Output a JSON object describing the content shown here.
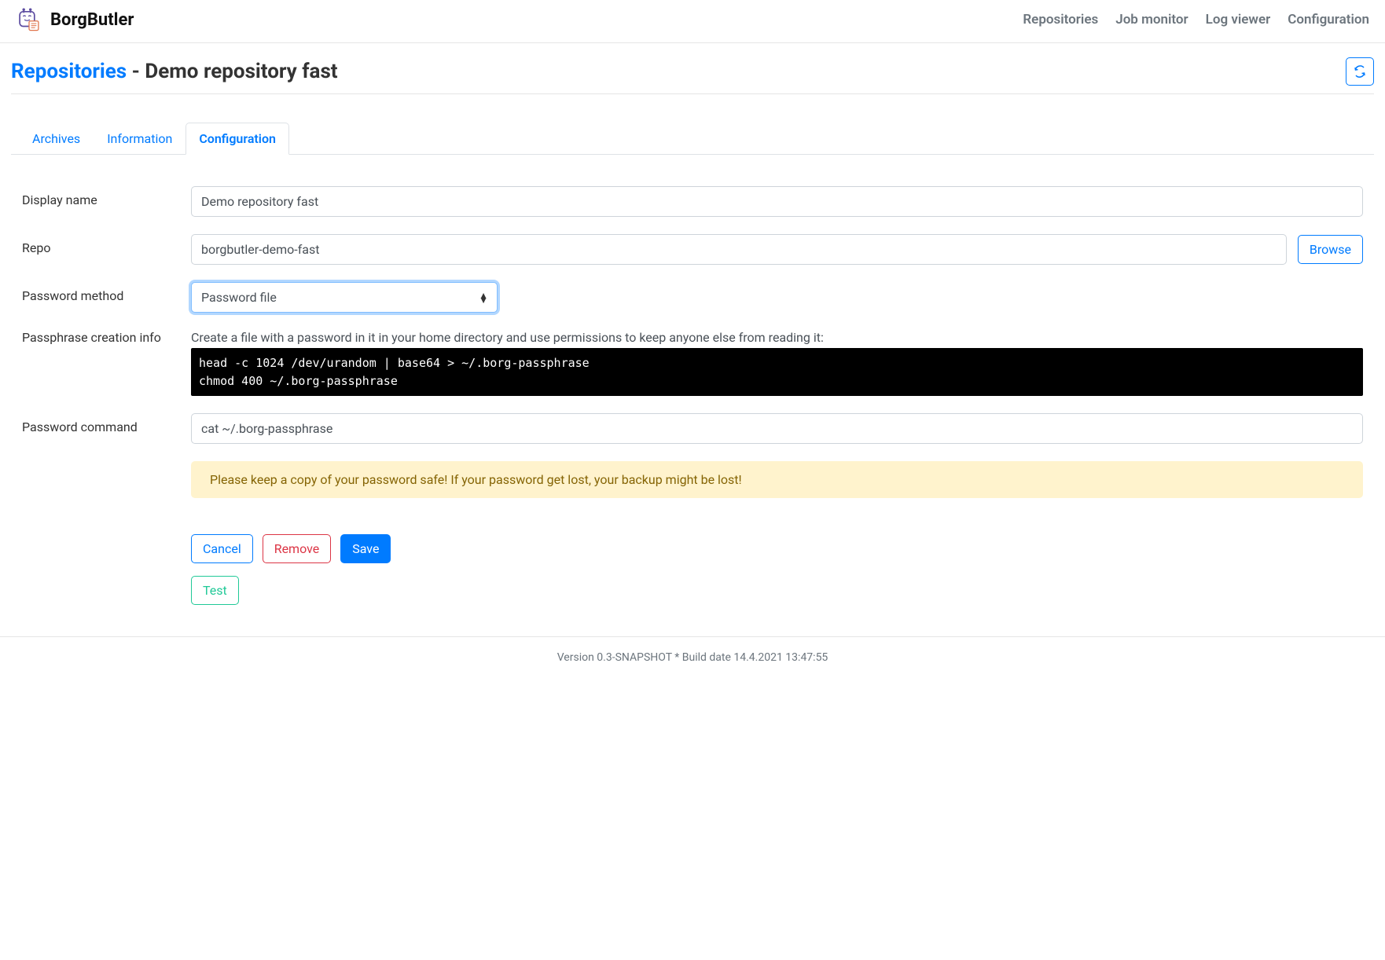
{
  "brand": "BorgButler",
  "nav": {
    "repositories": "Repositories",
    "job_monitor": "Job monitor",
    "log_viewer": "Log viewer",
    "configuration": "Configuration"
  },
  "header": {
    "link": "Repositories",
    "sep": " - ",
    "subtitle": "Demo repository fast"
  },
  "tabs": {
    "archives": "Archives",
    "information": "Information",
    "configuration": "Configuration"
  },
  "form": {
    "display_name": {
      "label": "Display name",
      "value": "Demo repository fast"
    },
    "repo": {
      "label": "Repo",
      "value": "borgbutler-demo-fast",
      "browse": "Browse"
    },
    "password_method": {
      "label": "Password method",
      "value": "Password file"
    },
    "passphrase_info": {
      "label": "Passphrase creation info",
      "hint": "Create a file with a password in it in your home directory and use permissions to keep anyone else from reading it:",
      "code": "head -c 1024 /dev/urandom | base64 > ~/.borg-passphrase\nchmod 400 ~/.borg-passphrase"
    },
    "password_command": {
      "label": "Password command",
      "value": "cat ~/.borg-passphrase"
    },
    "warning": "Please keep a copy of your password safe! If your password get lost, your backup might be lost!",
    "buttons": {
      "cancel": "Cancel",
      "remove": "Remove",
      "save": "Save",
      "test": "Test"
    }
  },
  "footer": "Version 0.3-SNAPSHOT * Build date 14.4.2021 13:47:55"
}
